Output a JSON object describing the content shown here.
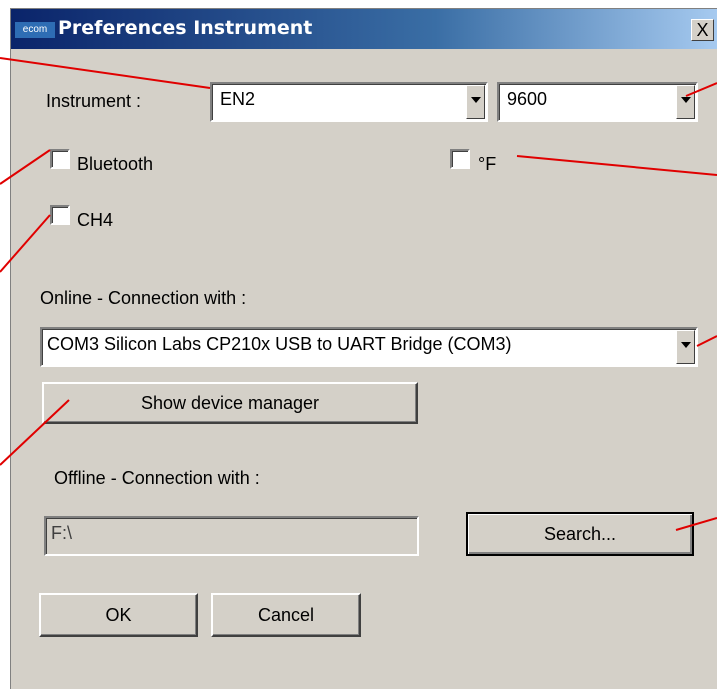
{
  "window": {
    "title": "Preferences Instrument",
    "icon_text": "ecom",
    "close_label": "X"
  },
  "instrument": {
    "label": "Instrument :",
    "selected": "EN2",
    "baud_selected": "9600"
  },
  "options": {
    "bluetooth_label": "Bluetooth",
    "ch4_label": "CH4",
    "fahrenheit_label": "°F"
  },
  "online": {
    "label": "Online - Connection with :",
    "selected": "COM3 Silicon Labs CP210x USB to UART Bridge (COM3)",
    "device_manager_label": "Show device manager"
  },
  "offline": {
    "label": "Offline - Connection with :",
    "path_value": "F:\\",
    "search_label": "Search..."
  },
  "footer": {
    "ok_label": "OK",
    "cancel_label": "Cancel"
  },
  "colors": {
    "annotation_line": "#e00000",
    "dialog_bg": "#d4d0c8",
    "titlebar": "#0a246a"
  }
}
